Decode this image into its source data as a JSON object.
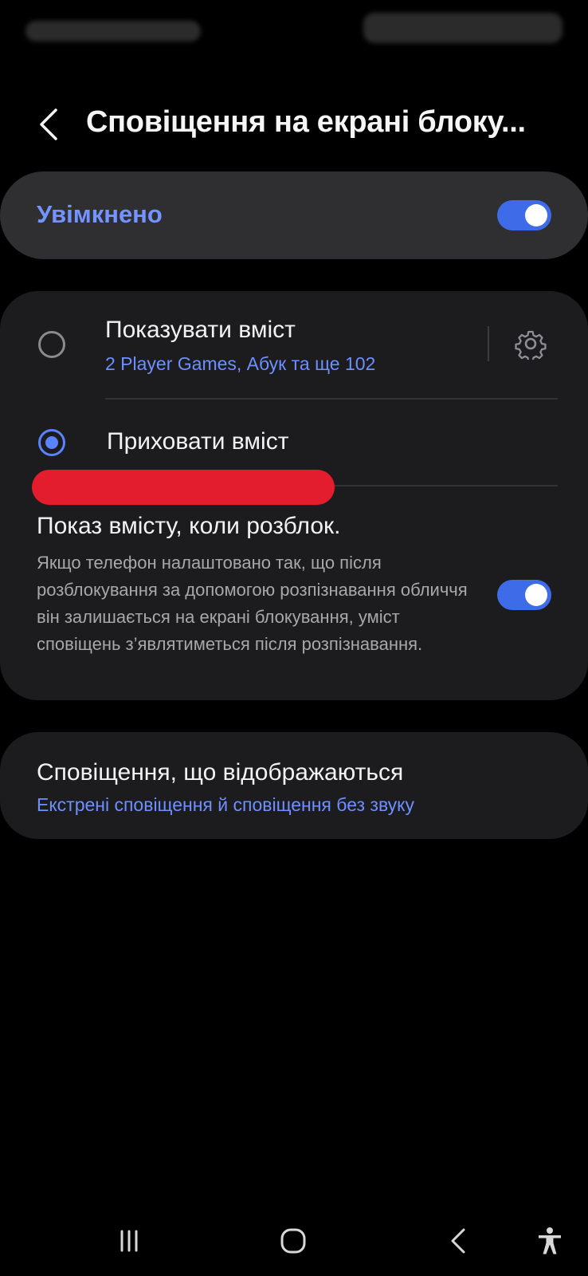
{
  "header": {
    "title": "Сповіщення на екрані блоку..."
  },
  "master": {
    "label": "Увімкнено",
    "enabled": true
  },
  "options": {
    "show_content": {
      "title": "Показувати вміст",
      "subtitle": "2 Player Games, Абук та ще 102",
      "selected": false
    },
    "hide_content": {
      "title": "Приховати вміст",
      "selected": true
    },
    "unlock": {
      "title": "Показ вмісту, коли розблок.",
      "description": "Якщо телефон налаштовано так, що після розблокування за допомогою розпізнавання обличчя він залишається на екрані блокування, уміст сповіщень з’являтиметься після розпізнавання.",
      "enabled": true
    }
  },
  "shown_notifications": {
    "title": "Сповіщення, що відображаються",
    "subtitle": "Екстрені сповіщення й сповіщення без звуку"
  },
  "colors": {
    "accent": "#5b82ff",
    "toggle_on": "#3e6ce8",
    "redaction": "#e31c2e",
    "card": "#1c1c1e"
  },
  "icons": {
    "back": "chevron-left-icon",
    "settings": "gear-icon",
    "recents": "recents-icon",
    "home": "home-icon",
    "nav_back": "back-icon",
    "accessibility": "accessibility-icon"
  }
}
